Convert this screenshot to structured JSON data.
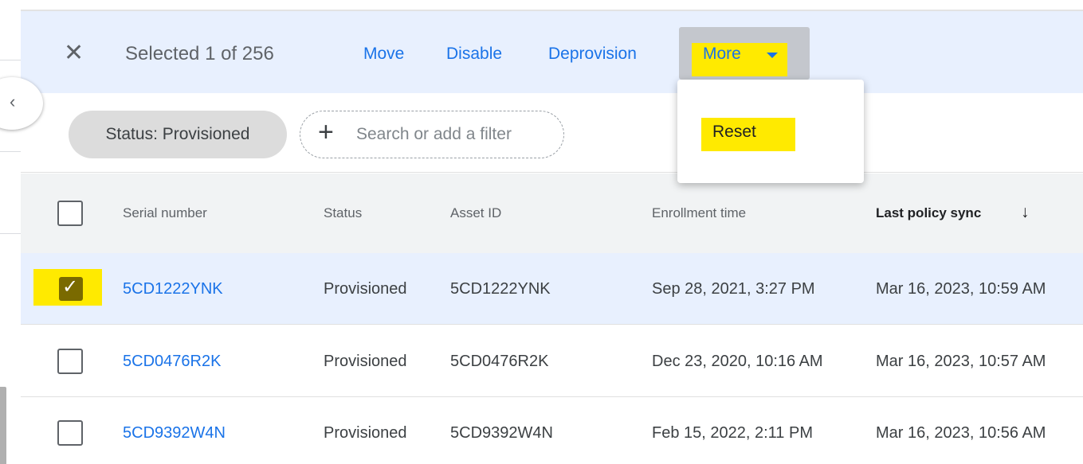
{
  "action_bar": {
    "close_icon": "close-icon",
    "selection_text": "Selected 1 of 256",
    "actions": [
      "Move",
      "Disable",
      "Deprovision"
    ],
    "more_label": "More",
    "more_icon": "caret-down-icon",
    "highlight_color": "#ffea00",
    "accent_color": "#1a73e8"
  },
  "filters": {
    "chip_label": "Status: Provisioned",
    "add_filter_placeholder": "Search or add a filter",
    "add_icon": "plus-icon"
  },
  "more_menu": {
    "items": [
      "Reset"
    ]
  },
  "table": {
    "headers": [
      "Serial number",
      "Status",
      "Asset ID",
      "Enrollment time",
      "Last policy sync"
    ],
    "sort_icon": "arrow-down-icon",
    "rows": [
      {
        "serial": "5CD1222YNK",
        "status": "Provisioned",
        "asset_id": "5CD1222YNK",
        "enrollment": "Sep 28, 2021, 3:27 PM",
        "last_sync": "Mar 16, 2023, 10:59 AM",
        "selected": true
      },
      {
        "serial": "5CD0476R2K",
        "status": "Provisioned",
        "asset_id": "5CD0476R2K",
        "enrollment": "Dec 23, 2020, 10:16 AM",
        "last_sync": "Mar 16, 2023, 10:57 AM",
        "selected": false
      },
      {
        "serial": "5CD9392W4N",
        "status": "Provisioned",
        "asset_id": "5CD9392W4N",
        "enrollment": "Feb 15, 2022, 2:11 PM",
        "last_sync": "Mar 16, 2023, 10:56 AM",
        "selected": false
      }
    ]
  },
  "sidebar": {
    "collapse_icon": "chevron-left-icon"
  }
}
